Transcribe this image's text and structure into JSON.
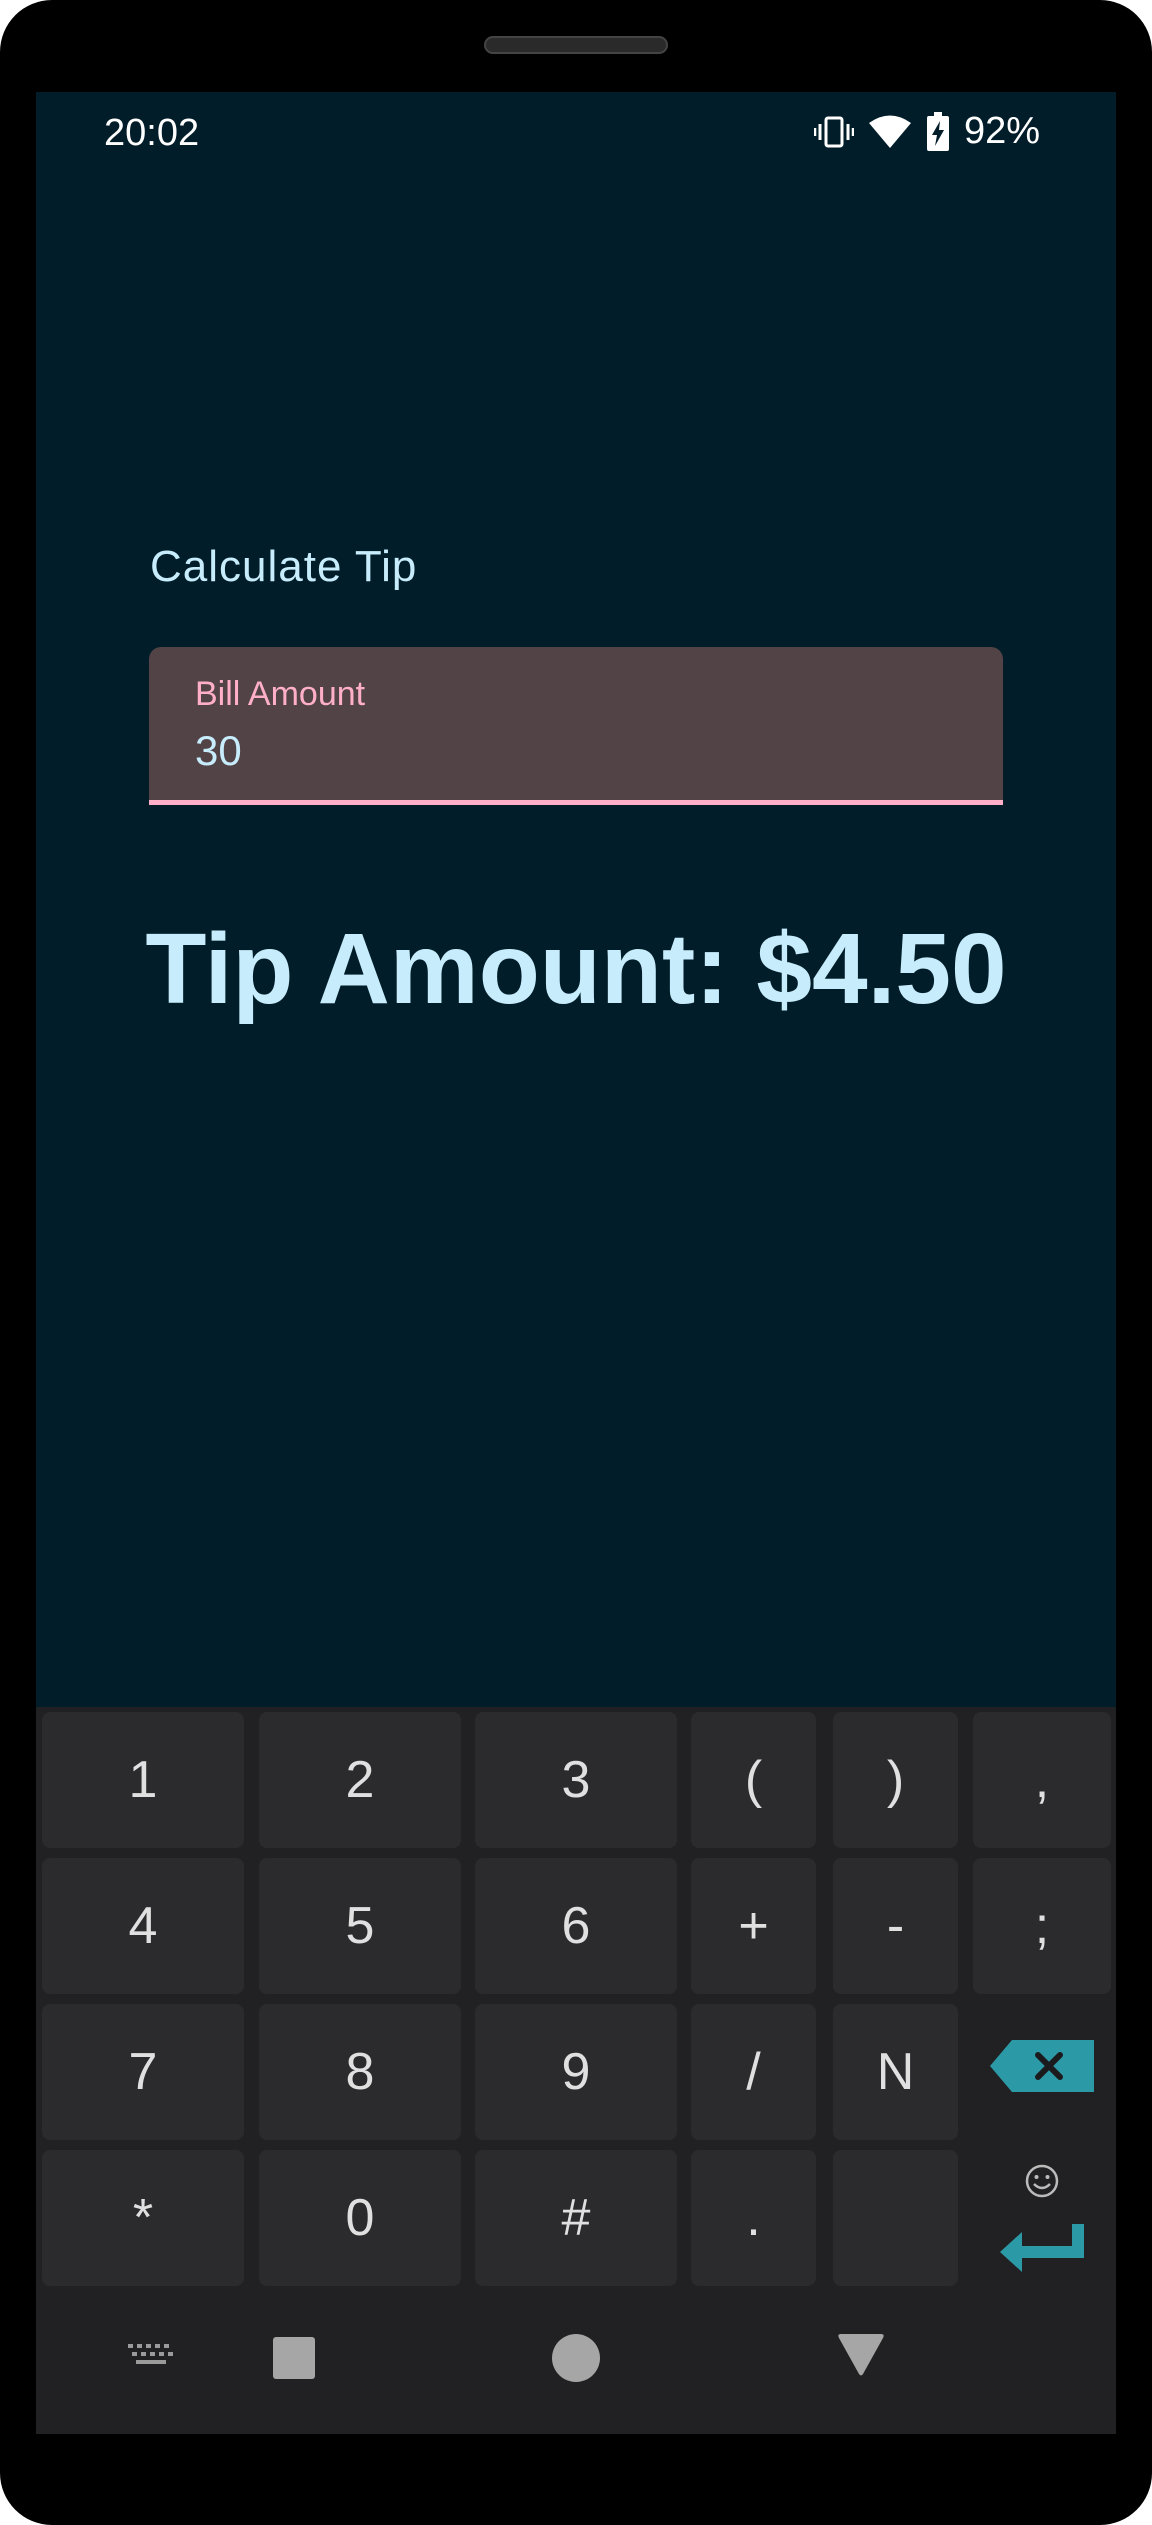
{
  "status_bar": {
    "time": "20:02",
    "battery": "92%",
    "icons": [
      "vibrate-icon",
      "wifi-icon",
      "battery-charging-icon"
    ]
  },
  "app": {
    "title": "Calculate Tip",
    "bill_field": {
      "label": "Bill Amount",
      "value": "30"
    },
    "tip_text": "Tip Amount: $4.50"
  },
  "keyboard": {
    "rows": [
      [
        "1",
        "2",
        "3",
        "(",
        ")",
        ","
      ],
      [
        "4",
        "5",
        "6",
        "+",
        "-",
        ";"
      ],
      [
        "7",
        "8",
        "9",
        "/",
        "N",
        ""
      ],
      [
        "*",
        "0",
        "#",
        ".",
        "",
        ""
      ]
    ],
    "backspace_icon": "backspace-icon",
    "enter_icon": "enter-icon",
    "emoji_icon": "emoji-icon"
  },
  "nav_bar": {
    "icons": [
      "keyboard-hide-icon",
      "recents-square-icon",
      "home-circle-icon",
      "back-triangle-icon"
    ]
  },
  "colors": {
    "background": "#011d29",
    "accent_text": "#c7ecfb",
    "field_bg": "#524347",
    "field_label": "#ffb0c8",
    "keyboard_bg": "#212123",
    "key_bg": "#2b2b2d",
    "action_key": "#2c9aa6"
  }
}
